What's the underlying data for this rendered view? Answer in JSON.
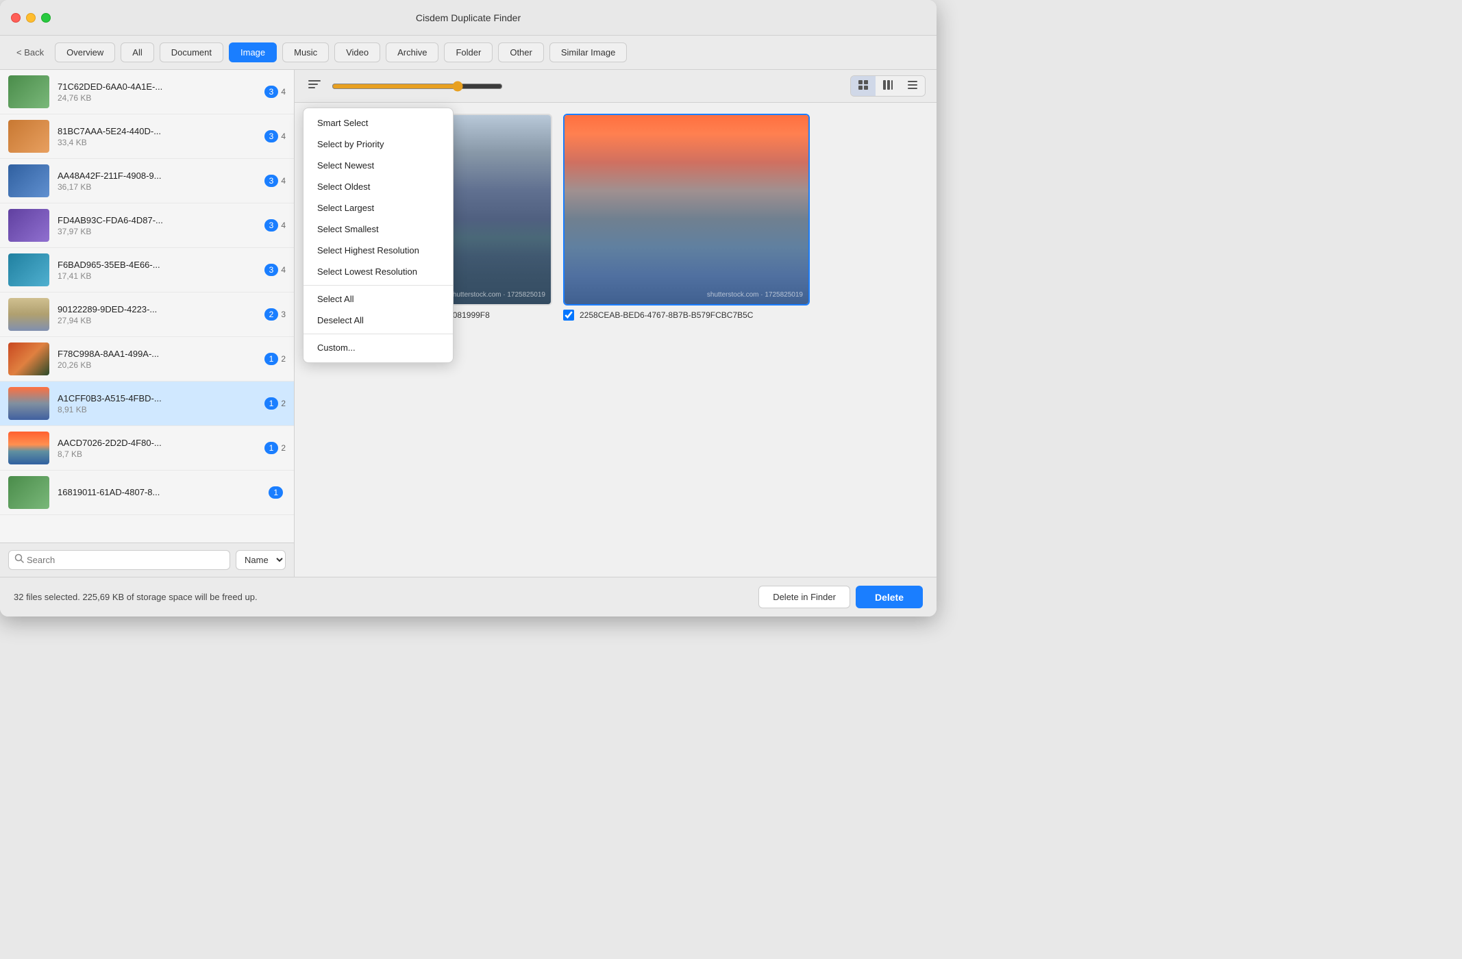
{
  "window": {
    "title": "Cisdem Duplicate Finder"
  },
  "toolbar": {
    "back_label": "< Back",
    "tabs": [
      {
        "id": "overview",
        "label": "Overview",
        "active": false
      },
      {
        "id": "all",
        "label": "All",
        "active": false
      },
      {
        "id": "document",
        "label": "Document",
        "active": false
      },
      {
        "id": "image",
        "label": "Image",
        "active": true
      },
      {
        "id": "music",
        "label": "Music",
        "active": false
      },
      {
        "id": "video",
        "label": "Video",
        "active": false
      },
      {
        "id": "archive",
        "label": "Archive",
        "active": false
      },
      {
        "id": "folder",
        "label": "Folder",
        "active": false
      },
      {
        "id": "other",
        "label": "Other",
        "active": false
      },
      {
        "id": "similar-image",
        "label": "Similar Image",
        "active": false
      }
    ]
  },
  "sidebar": {
    "items": [
      {
        "id": 1,
        "name": "71C62DED-6AA0-4A1E-...",
        "size": "24,76 KB",
        "count1": "3",
        "count2": "4",
        "thumb": "green"
      },
      {
        "id": 2,
        "name": "81BC7AAA-5E24-440D-...",
        "size": "33,4 KB",
        "count1": "3",
        "count2": "4",
        "thumb": "orange"
      },
      {
        "id": 3,
        "name": "AA48A42F-211F-4908-9...",
        "size": "36,17 KB",
        "count1": "3",
        "count2": "4",
        "thumb": "blue"
      },
      {
        "id": 4,
        "name": "FD4AB93C-FDA6-4D87-...",
        "size": "37,97 KB",
        "count1": "3",
        "count2": "4",
        "thumb": "purple"
      },
      {
        "id": 5,
        "name": "F6BAD965-35EB-4E66-...",
        "size": "17,41 KB",
        "count1": "3",
        "count2": "4",
        "thumb": "teal"
      },
      {
        "id": 6,
        "name": "90122289-9DED-4223-...",
        "size": "27,94 KB",
        "count1": "2",
        "count2": "3",
        "thumb": "taj"
      },
      {
        "id": 7,
        "name": "F78C998A-8AA1-499A-...",
        "size": "20,26 KB",
        "count1": "1",
        "count2": "2",
        "thumb": "fox"
      },
      {
        "id": 8,
        "name": "A1CFF0B3-A515-4FBD-...",
        "size": "8,91 KB",
        "count1": "1",
        "count2": "2",
        "thumb": "mountain",
        "selected": true
      },
      {
        "id": 9,
        "name": "AACD7026-2D2D-4F80-...",
        "size": "8,7 KB",
        "count1": "1",
        "count2": "2",
        "thumb": "sunset"
      },
      {
        "id": 10,
        "name": "16819011-61AD-4807-8...",
        "size": "",
        "count1": "1",
        "count2": "",
        "thumb": "green"
      }
    ],
    "search_placeholder": "Search",
    "sort_label": "Name"
  },
  "dropdown": {
    "items": [
      {
        "id": "smart-select",
        "label": "Smart Select",
        "divider_after": false
      },
      {
        "id": "select-by-priority",
        "label": "Select by Priority",
        "divider_after": false
      },
      {
        "id": "select-newest",
        "label": "Select Newest",
        "divider_after": false
      },
      {
        "id": "select-oldest",
        "label": "Select Oldest",
        "divider_after": false
      },
      {
        "id": "select-largest",
        "label": "Select Largest",
        "divider_after": false
      },
      {
        "id": "select-smallest",
        "label": "Select Smallest",
        "divider_after": false
      },
      {
        "id": "select-highest-resolution",
        "label": "Select Highest Resolution",
        "divider_after": false
      },
      {
        "id": "select-lowest-resolution",
        "label": "Select Lowest Resolution",
        "divider_after": true
      },
      {
        "id": "select-all",
        "label": "Select All",
        "divider_after": false
      },
      {
        "id": "deselect-all",
        "label": "Deselect All",
        "divider_after": true
      },
      {
        "id": "custom",
        "label": "Custom...",
        "divider_after": false
      }
    ]
  },
  "panel": {
    "image1": {
      "name": "A1CFF0B3-A515-4FBD-A3F3-05E8081999F8",
      "watermark": "shutterstock.com · 1725825019",
      "checked": false
    },
    "image2": {
      "name": "2258CEAB-BED6-4767-8B7B-B579FCBC7B5C",
      "watermark": "shutterstock.com · 1725825019",
      "checked": true
    }
  },
  "status": {
    "text": "32 files selected. 225,69 KB of storage space will be freed up."
  },
  "buttons": {
    "delete_in_finder": "Delete in Finder",
    "delete": "Delete"
  }
}
